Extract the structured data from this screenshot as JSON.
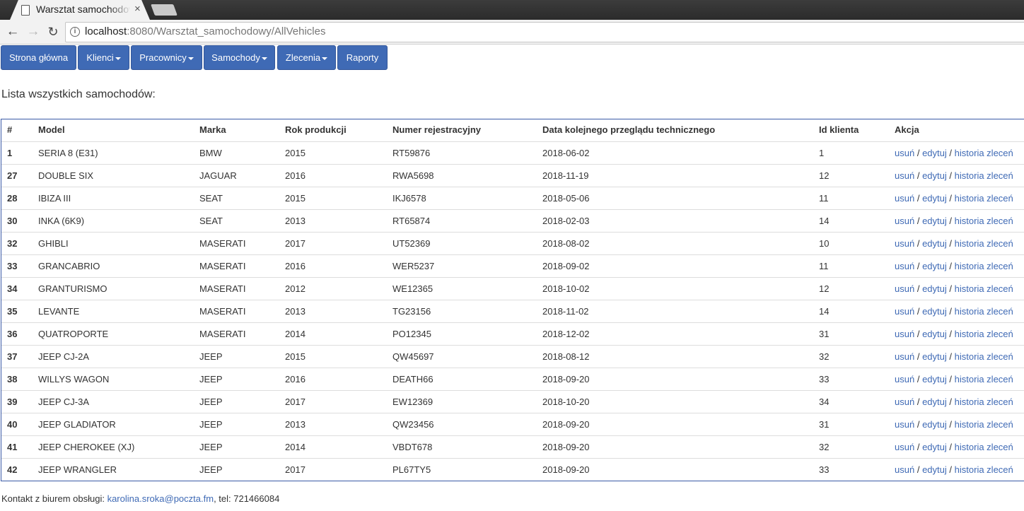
{
  "browser": {
    "tab_title": "Warsztat samochodowy",
    "tab_close": "×",
    "url_host": "localhost",
    "url_path": ":8080/Warsztat_samochodowy/AllVehicles",
    "icons": {
      "back": "back-arrow-icon",
      "forward": "forward-arrow-icon",
      "reload": "reload-icon",
      "info": "info-icon"
    }
  },
  "nav": {
    "home": "Strona główna",
    "clients": "Klienci",
    "employees": "Pracownicy",
    "cars": "Samochody",
    "orders": "Zlecenia",
    "reports": "Raporty",
    "accent_color": "#3f6ab5"
  },
  "page": {
    "heading": "Lista wszystkich samochodów:"
  },
  "table": {
    "headers": {
      "id": "#",
      "model": "Model",
      "brand": "Marka",
      "year": "Rok produkcji",
      "plate": "Numer rejestracyjny",
      "inspection": "Data kolejnego przeglądu technicznego",
      "client": "Id klienta",
      "action": "Akcja"
    },
    "actions": {
      "delete": "usuń",
      "edit": "edytuj",
      "history": "historia zleceń",
      "separator": "/"
    },
    "rows": [
      {
        "id": "1",
        "model": "SERIA 8 (E31)",
        "brand": "BMW",
        "year": "2015",
        "plate": "RT59876",
        "inspection": "2018-06-02",
        "client": "1"
      },
      {
        "id": "27",
        "model": "DOUBLE SIX",
        "brand": "JAGUAR",
        "year": "2016",
        "plate": "RWA5698",
        "inspection": "2018-11-19",
        "client": "12"
      },
      {
        "id": "28",
        "model": "IBIZA III",
        "brand": "SEAT",
        "year": "2015",
        "plate": "IKJ6578",
        "inspection": "2018-05-06",
        "client": "11"
      },
      {
        "id": "30",
        "model": "INKA (6K9)",
        "brand": "SEAT",
        "year": "2013",
        "plate": "RT65874",
        "inspection": "2018-02-03",
        "client": "14"
      },
      {
        "id": "32",
        "model": "GHIBLI",
        "brand": "MASERATI",
        "year": "2017",
        "plate": "UT52369",
        "inspection": "2018-08-02",
        "client": "10"
      },
      {
        "id": "33",
        "model": "GRANCABRIO",
        "brand": "MASERATI",
        "year": "2016",
        "plate": "WER5237",
        "inspection": "2018-09-02",
        "client": "11"
      },
      {
        "id": "34",
        "model": "GRANTURISMO",
        "brand": "MASERATI",
        "year": "2012",
        "plate": "WE12365",
        "inspection": "2018-10-02",
        "client": "12"
      },
      {
        "id": "35",
        "model": "LEVANTE",
        "brand": "MASERATI",
        "year": "2013",
        "plate": "TG23156",
        "inspection": "2018-11-02",
        "client": "14"
      },
      {
        "id": "36",
        "model": "QUATROPORTE",
        "brand": "MASERATI",
        "year": "2014",
        "plate": "PO12345",
        "inspection": "2018-12-02",
        "client": "31"
      },
      {
        "id": "37",
        "model": "JEEP CJ-2A",
        "brand": "JEEP",
        "year": "2015",
        "plate": "QW45697",
        "inspection": "2018-08-12",
        "client": "32"
      },
      {
        "id": "38",
        "model": "WILLYS WAGON",
        "brand": "JEEP",
        "year": "2016",
        "plate": "DEATH66",
        "inspection": "2018-09-20",
        "client": "33"
      },
      {
        "id": "39",
        "model": "JEEP CJ-3A",
        "brand": "JEEP",
        "year": "2017",
        "plate": "EW12369",
        "inspection": "2018-10-20",
        "client": "34"
      },
      {
        "id": "40",
        "model": "JEEP GLADIATOR",
        "brand": "JEEP",
        "year": "2013",
        "plate": "QW23456",
        "inspection": "2018-09-20",
        "client": "31"
      },
      {
        "id": "41",
        "model": "JEEP CHEROKEE (XJ)",
        "brand": "JEEP",
        "year": "2014",
        "plate": "VBDT678",
        "inspection": "2018-09-20",
        "client": "32"
      },
      {
        "id": "42",
        "model": "JEEP WRANGLER",
        "brand": "JEEP",
        "year": "2017",
        "plate": "PL67TY5",
        "inspection": "2018-09-20",
        "client": "33"
      }
    ]
  },
  "footer": {
    "prefix": "Kontakt z biurem obsługi: ",
    "email": "karolina.sroka@poczta.fm",
    "suffix": ", tel: 721466084"
  }
}
